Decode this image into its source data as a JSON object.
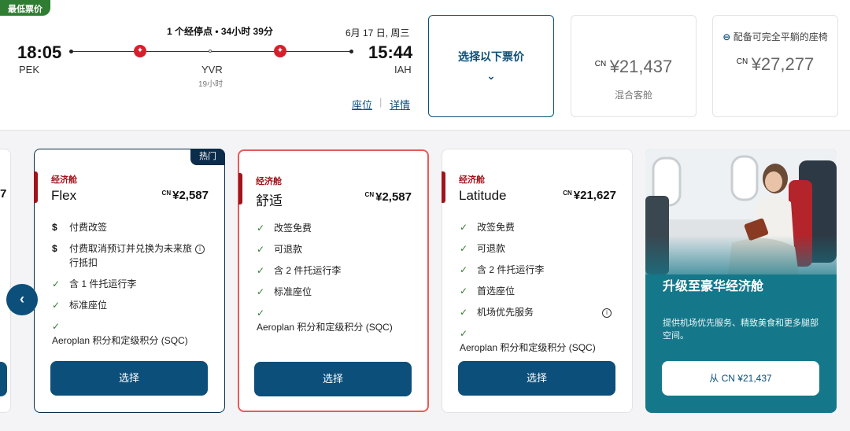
{
  "flight": {
    "badge": "最低票价",
    "depart_time": "18:05",
    "depart_code": "PEK",
    "arrive_time": "15:44",
    "arrive_code": "IAH",
    "stops_summary": "1 个经停点 • 34小时 39分",
    "date": "6月 17 日, 周三",
    "stop_code": "YVR",
    "layover": "19小时",
    "seats_link": "座位",
    "details_link": "详情",
    "select_fare_label": "选择以下票价",
    "mixed_cabin": {
      "currency": "CN",
      "price": "¥21,437",
      "label": "混合客舱"
    },
    "lie_flat": {
      "note": "配备可完全平躺的座椅",
      "currency": "CN",
      "price": "¥27,277"
    }
  },
  "partial_card": {
    "digit": "7"
  },
  "fares": [
    {
      "cabin": "经济舱",
      "name": "Flex",
      "currency": "CN",
      "price": "¥2,587",
      "badge": "热门",
      "features": [
        {
          "icon": "dollar-icon",
          "text": "付费改签"
        },
        {
          "icon": "dollar-icon",
          "text": "付费取消预订并兑换为未来旅行抵扣"
        },
        {
          "icon": "check-icon",
          "text": "含 1 件托运行李"
        },
        {
          "icon": "check-icon",
          "text": "标准座位"
        },
        {
          "icon": "check-icon",
          "text": "Aeroplan 积分和定级积分 (SQC)"
        }
      ],
      "select_label": "选择"
    },
    {
      "cabin": "经济舱",
      "name": "舒适",
      "currency": "CN",
      "price": "¥2,587",
      "features": [
        {
          "icon": "check-icon",
          "text": "改签免费"
        },
        {
          "icon": "check-icon",
          "text": "可退款"
        },
        {
          "icon": "check-icon",
          "text": "含 2 件托运行李"
        },
        {
          "icon": "check-icon",
          "text": "标准座位"
        },
        {
          "icon": "check-icon",
          "text": "Aeroplan 积分和定级积分 (SQC)"
        }
      ],
      "select_label": "选择"
    },
    {
      "cabin": "经济舱",
      "name": "Latitude",
      "currency": "CN",
      "price": "¥21,627",
      "features": [
        {
          "icon": "check-icon",
          "text": "改签免费"
        },
        {
          "icon": "check-icon",
          "text": "可退款"
        },
        {
          "icon": "check-icon",
          "text": "含 2 件托运行李"
        },
        {
          "icon": "check-icon",
          "text": "首选座位"
        },
        {
          "icon": "check-icon",
          "text": "机场优先服务"
        },
        {
          "icon": "check-icon",
          "text": "Aeroplan 积分和定级积分 (SQC)"
        }
      ],
      "select_label": "选择"
    }
  ],
  "promo": {
    "title": "升级至豪华经济舱",
    "description": "提供机场优先服务、精致美食和更多腿部空间。",
    "button_label": "从 CN ¥21,437"
  },
  "colors": {
    "brand_blue": "#0b4f7a",
    "cabin_red": "#a0141c",
    "highlight_border": "#e85a5a",
    "badge_green": "#2f7d32",
    "promo_teal": "#14788a"
  }
}
